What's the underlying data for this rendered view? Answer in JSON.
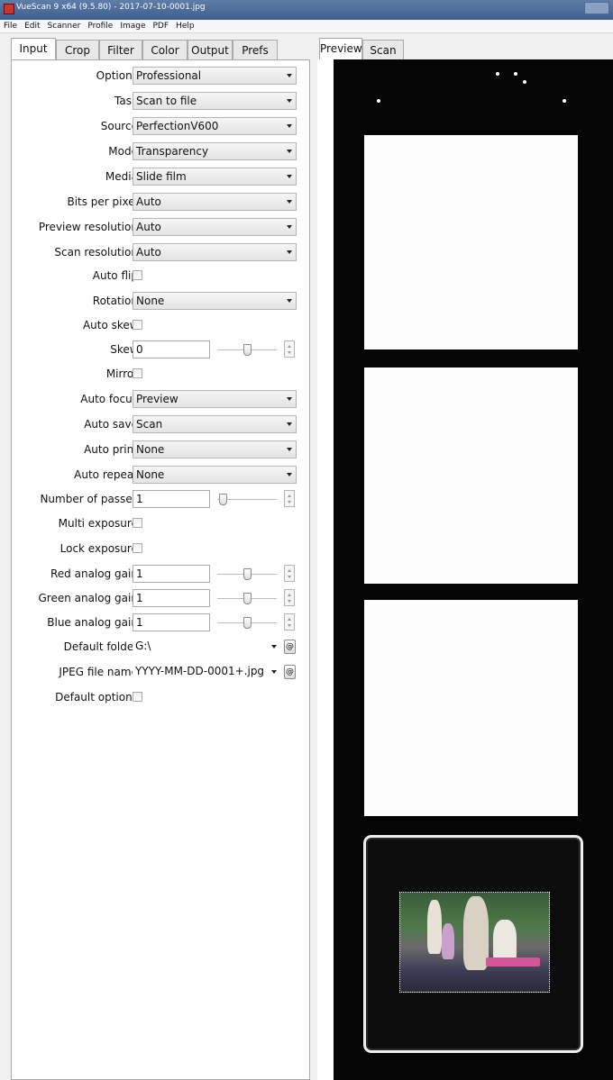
{
  "window": {
    "title": "VueScan 9 x64 (9.5.80) - 2017-07-10-0001.jpg"
  },
  "menu": [
    "File",
    "Edit",
    "Scanner",
    "Profile",
    "Image",
    "PDF",
    "Help"
  ],
  "left_tabs": [
    "Input",
    "Crop",
    "Filter",
    "Color",
    "Output",
    "Prefs"
  ],
  "active_left_tab": "Input",
  "right_tabs": [
    "Preview",
    "Scan"
  ],
  "active_right_tab": "Preview",
  "form": {
    "options": {
      "label": "Options:",
      "value": "Professional"
    },
    "task": {
      "label": "Task:",
      "value": "Scan to file"
    },
    "source": {
      "label": "Source:",
      "value": "PerfectionV600"
    },
    "mode": {
      "label": "Mode:",
      "value": "Transparency"
    },
    "media": {
      "label": "Media:",
      "value": "Slide film"
    },
    "bits": {
      "label": "Bits per pixel:",
      "value": "Auto"
    },
    "preview_res": {
      "label": "Preview resolution:",
      "value": "Auto"
    },
    "scan_res": {
      "label": "Scan resolution:",
      "value": "Auto"
    },
    "auto_flip": {
      "label": "Auto flip:"
    },
    "rotation": {
      "label": "Rotation:",
      "value": "None"
    },
    "auto_skew": {
      "label": "Auto skew:"
    },
    "skew": {
      "label": "Skew:",
      "value": "0"
    },
    "mirror": {
      "label": "Mirror:"
    },
    "auto_focus": {
      "label": "Auto focus:",
      "value": "Preview"
    },
    "auto_save": {
      "label": "Auto save:",
      "value": "Scan"
    },
    "auto_print": {
      "label": "Auto print:",
      "value": "None"
    },
    "auto_repeat": {
      "label": "Auto repeat:",
      "value": "None"
    },
    "passes": {
      "label": "Number of passes:",
      "value": "1"
    },
    "multi_exposure": {
      "label": "Multi exposure:"
    },
    "lock_exposure": {
      "label": "Lock exposure:"
    },
    "red_gain": {
      "label": "Red analog gain:",
      "value": "1"
    },
    "green_gain": {
      "label": "Green analog gain:",
      "value": "1"
    },
    "blue_gain": {
      "label": "Blue analog gain:",
      "value": "1"
    },
    "default_folder": {
      "label": "Default folder:",
      "value": "G:\\"
    },
    "jpeg_name": {
      "label": "JPEG file name:",
      "value": "YYYY-MM-DD-0001+.jpg"
    },
    "default_options": {
      "label": "Default options:"
    },
    "browse_glyph": "@"
  }
}
